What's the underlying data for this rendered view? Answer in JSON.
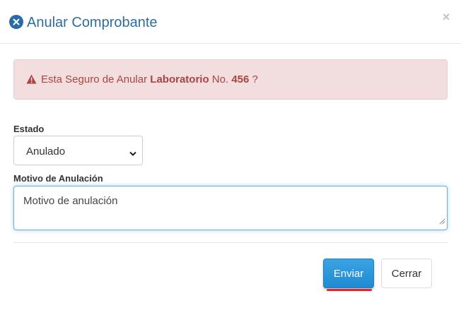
{
  "modal": {
    "title": "Anular Comprobante",
    "close_label": "×"
  },
  "alert": {
    "prefix": "Esta Seguro de Anular",
    "entity": "Laboratorio",
    "no_label": "No.",
    "number": "456",
    "suffix": "?"
  },
  "form": {
    "estado_label": "Estado",
    "estado_value": "Anulado",
    "motivo_label": "Motivo de Anulación",
    "motivo_value": "Motivo de anulación"
  },
  "footer": {
    "submit_label": "Enviar",
    "close_label": "Cerrar"
  },
  "colors": {
    "title": "#2e6da4",
    "alert_bg": "#f2dede",
    "alert_text": "#a94442",
    "primary": "#2596dd",
    "highlight": "#e8202a"
  },
  "icons": {
    "title": "times-circle-icon",
    "alert": "warning-triangle-icon",
    "select": "chevron-down-icon"
  }
}
